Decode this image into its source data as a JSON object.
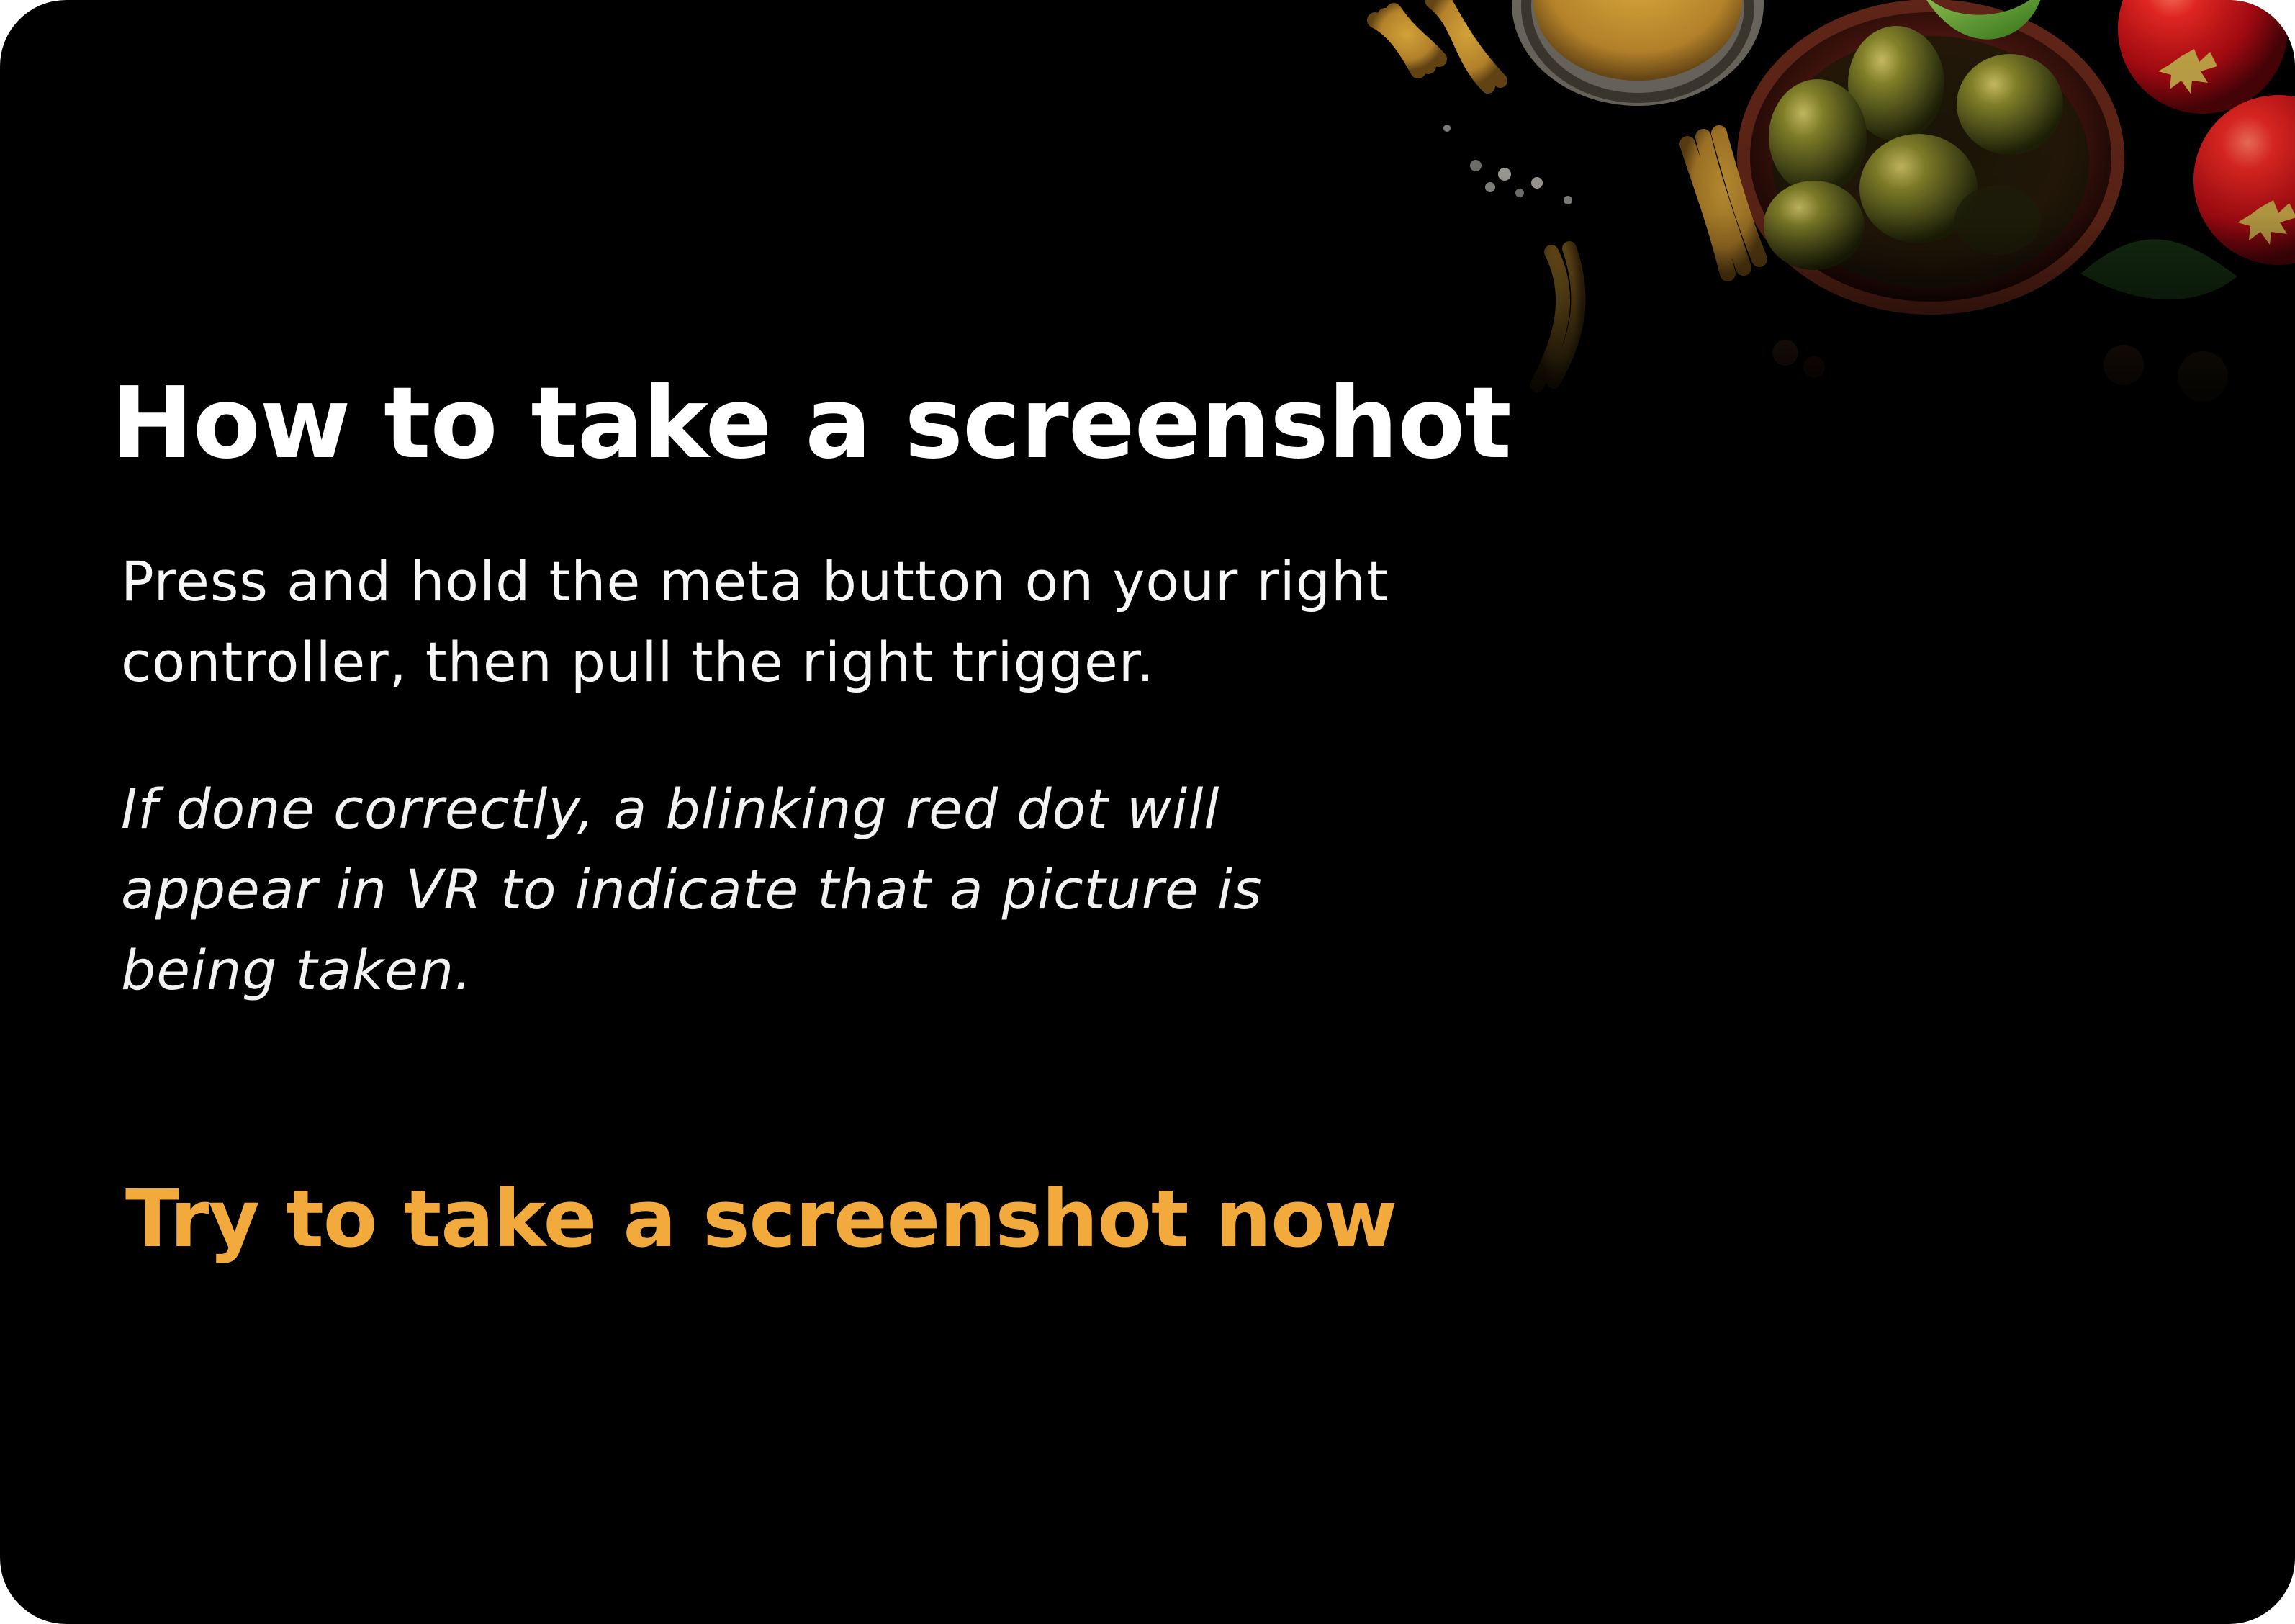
{
  "screen": {
    "title": "How to take a screenshot",
    "instruction": "Press and hold the meta button on your right controller, then pull the right trigger.",
    "note": "If done correctly, a blinking red dot will appear in VR to indicate that a picture is being taken.",
    "action_label": "Try to take a screenshot now"
  },
  "decoration": {
    "name": "food-ingredients-image",
    "colors": {
      "background": "#000000",
      "accent": "#f3aa3d",
      "olive": "#747a26",
      "tomato": "#d3121a",
      "bowl": "#4a1710",
      "pasta": "#b28b32"
    }
  }
}
